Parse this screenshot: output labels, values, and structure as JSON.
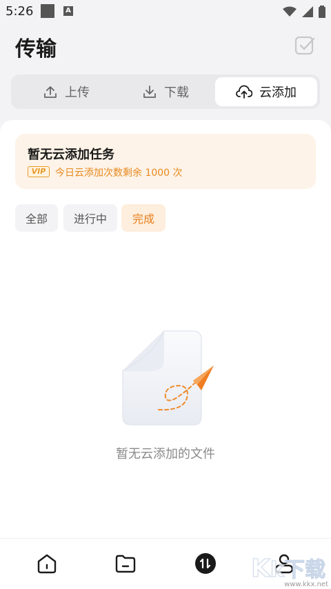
{
  "status_bar": {
    "time": "5:26",
    "a_icon_letter": "A"
  },
  "header": {
    "title": "传输"
  },
  "tabs": [
    {
      "label": "上传",
      "icon": "upload-icon"
    },
    {
      "label": "下载",
      "icon": "download-icon"
    },
    {
      "label": "云添加",
      "icon": "cloud-upload-icon",
      "active": true
    }
  ],
  "notice": {
    "title": "暂无云添加任务",
    "vip_badge": "VIP",
    "subtitle": "今日云添加次数剩余 1000 次"
  },
  "filters": [
    {
      "label": "全部"
    },
    {
      "label": "进行中"
    },
    {
      "label": "完成",
      "active": true
    }
  ],
  "empty_state": {
    "text": "暂无云添加的文件"
  },
  "bottom_nav": [
    {
      "icon": "home-icon"
    },
    {
      "icon": "folder-icon"
    },
    {
      "icon": "transfer-icon",
      "active": true
    },
    {
      "icon": "profile-icon"
    }
  ],
  "watermark": {
    "text": "www.kkx.net"
  },
  "colors": {
    "accent": "#ea7d1a",
    "vip": "#e79a2a",
    "notice_bg": "#fdf3e8"
  }
}
